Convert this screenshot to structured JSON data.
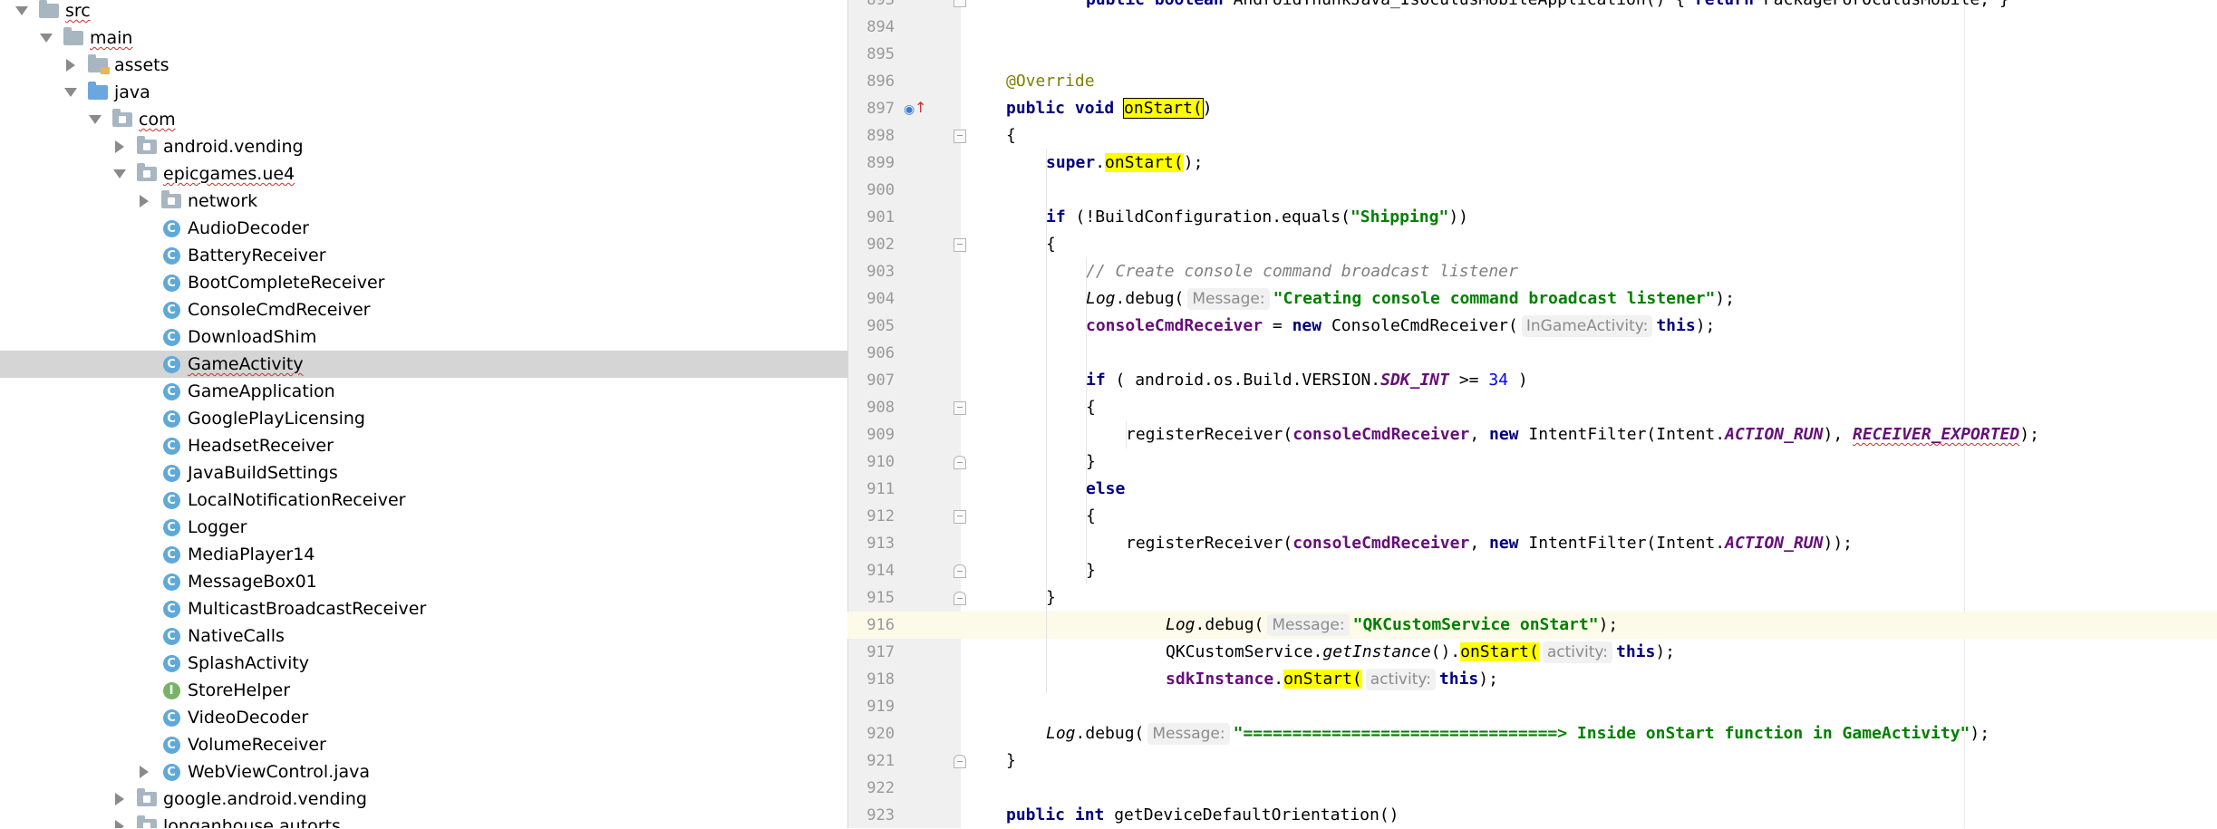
{
  "tree": {
    "items": [
      {
        "label": "src",
        "depth": 0,
        "expanded": true,
        "icon": "folder-icon"
      },
      {
        "label": "main",
        "depth": 1,
        "expanded": true,
        "icon": "folder-icon"
      },
      {
        "label": "assets",
        "depth": 2,
        "expanded": false,
        "icon": "resource-folder-icon"
      },
      {
        "label": "java",
        "depth": 2,
        "expanded": true,
        "icon": "source-folder-icon"
      },
      {
        "label": "com",
        "depth": 3,
        "expanded": true,
        "icon": "package-icon"
      },
      {
        "label": "android.vending",
        "depth": 4,
        "expanded": false,
        "icon": "package-icon"
      },
      {
        "label": "epicgames.ue4",
        "depth": 4,
        "expanded": true,
        "icon": "package-icon"
      },
      {
        "label": "network",
        "depth": 5,
        "expanded": false,
        "icon": "package-icon"
      },
      {
        "label": "AudioDecoder",
        "depth": 5,
        "icon": "class-icon"
      },
      {
        "label": "BatteryReceiver",
        "depth": 5,
        "icon": "class-icon"
      },
      {
        "label": "BootCompleteReceiver",
        "depth": 5,
        "icon": "class-icon"
      },
      {
        "label": "ConsoleCmdReceiver",
        "depth": 5,
        "icon": "class-icon"
      },
      {
        "label": "DownloadShim",
        "depth": 5,
        "icon": "class-icon"
      },
      {
        "label": "GameActivity",
        "depth": 5,
        "icon": "class-icon",
        "selected": true
      },
      {
        "label": "GameApplication",
        "depth": 5,
        "icon": "class-icon"
      },
      {
        "label": "GooglePlayLicensing",
        "depth": 5,
        "icon": "class-icon"
      },
      {
        "label": "HeadsetReceiver",
        "depth": 5,
        "icon": "class-icon"
      },
      {
        "label": "JavaBuildSettings",
        "depth": 5,
        "icon": "class-icon"
      },
      {
        "label": "LocalNotificationReceiver",
        "depth": 5,
        "icon": "class-icon"
      },
      {
        "label": "Logger",
        "depth": 5,
        "icon": "class-icon"
      },
      {
        "label": "MediaPlayer14",
        "depth": 5,
        "icon": "class-icon"
      },
      {
        "label": "MessageBox01",
        "depth": 5,
        "icon": "class-icon"
      },
      {
        "label": "MulticastBroadcastReceiver",
        "depth": 5,
        "icon": "class-icon"
      },
      {
        "label": "NativeCalls",
        "depth": 5,
        "icon": "class-icon"
      },
      {
        "label": "SplashActivity",
        "depth": 5,
        "icon": "class-icon"
      },
      {
        "label": "StoreHelper",
        "depth": 5,
        "icon": "interface-icon"
      },
      {
        "label": "VideoDecoder",
        "depth": 5,
        "icon": "class-icon"
      },
      {
        "label": "VolumeReceiver",
        "depth": 5,
        "icon": "class-icon"
      },
      {
        "label": "WebViewControl.java",
        "depth": 5,
        "expanded": false,
        "icon": "class-icon"
      },
      {
        "label": "google.android.vending",
        "depth": 4,
        "expanded": false,
        "icon": "package-icon"
      },
      {
        "label": "longanhouse.autorts",
        "depth": 4,
        "expanded": false,
        "icon": "package-icon"
      }
    ]
  },
  "editor": {
    "current_line": "916",
    "lines": [
      {
        "n": "893",
        "indent": 2,
        "tokens": [
          {
            "t": "public boolean ",
            "c": "kw"
          },
          {
            "t": "AndroidThunkJava_IsOculusMobileApplication() { "
          },
          {
            "t": "return ",
            "c": "kw"
          },
          {
            "t": "PackageForOculusMobile; }"
          }
        ]
      },
      {
        "n": "894",
        "indent": 0,
        "tokens": []
      },
      {
        "n": "895",
        "indent": 0,
        "tokens": []
      },
      {
        "n": "896",
        "indent": 0,
        "tokens": [
          {
            "t": "@Override",
            "c": "ann"
          }
        ]
      },
      {
        "n": "897",
        "indent": 0,
        "tokens": [
          {
            "t": "public void ",
            "c": "kw"
          },
          {
            "t": "onStart(",
            "c": "hlbox"
          },
          {
            "t": ")"
          }
        ]
      },
      {
        "n": "898",
        "indent": 0,
        "tokens": [
          {
            "t": "{"
          }
        ]
      },
      {
        "n": "899",
        "indent": 1,
        "tokens": [
          {
            "t": "super",
            "c": "kw"
          },
          {
            "t": "."
          },
          {
            "t": "onStart(",
            "c": "hl"
          },
          {
            "t": ");"
          }
        ]
      },
      {
        "n": "900",
        "indent": 0,
        "tokens": []
      },
      {
        "n": "901",
        "indent": 1,
        "tokens": [
          {
            "t": "if ",
            "c": "kw"
          },
          {
            "t": "(!BuildConfiguration.equals("
          },
          {
            "t": "\"Shipping\"",
            "c": "str"
          },
          {
            "t": "))"
          }
        ]
      },
      {
        "n": "902",
        "indent": 1,
        "tokens": [
          {
            "t": "{"
          }
        ]
      },
      {
        "n": "903",
        "indent": 2,
        "tokens": [
          {
            "t": "// Create console command broadcast listener",
            "c": "cmt"
          }
        ]
      },
      {
        "n": "904",
        "indent": 2,
        "tokens": [
          {
            "t": "Log",
            "c": "it"
          },
          {
            "t": ".debug("
          },
          {
            "hint": "Message:"
          },
          {
            "t": "\"Creating console command broadcast listener\"",
            "c": "str"
          },
          {
            "t": ");"
          }
        ]
      },
      {
        "n": "905",
        "indent": 2,
        "tokens": [
          {
            "t": "consoleCmdReceiver",
            "c": "fld"
          },
          {
            "t": " = "
          },
          {
            "t": "new ",
            "c": "kw"
          },
          {
            "t": "ConsoleCmdReceiver("
          },
          {
            "hint": "InGameActivity:"
          },
          {
            "t": "this",
            "c": "kw"
          },
          {
            "t": ");"
          }
        ]
      },
      {
        "n": "906",
        "indent": 0,
        "tokens": []
      },
      {
        "n": "907",
        "indent": 2,
        "tokens": [
          {
            "t": "if ",
            "c": "kw"
          },
          {
            "t": "( android.os.Build.VERSION."
          },
          {
            "t": "SDK_INT",
            "c": "sfld"
          },
          {
            "t": " >= "
          },
          {
            "t": "34",
            "c": "num"
          },
          {
            "t": " )"
          }
        ]
      },
      {
        "n": "908",
        "indent": 2,
        "tokens": [
          {
            "t": "{"
          }
        ]
      },
      {
        "n": "909",
        "indent": 3,
        "tokens": [
          {
            "t": "registerReceiver("
          },
          {
            "t": "consoleCmdReceiver",
            "c": "fld"
          },
          {
            "t": ", "
          },
          {
            "t": "new ",
            "c": "kw"
          },
          {
            "t": "IntentFilter(Intent."
          },
          {
            "t": "ACTION_RUN",
            "c": "sfld"
          },
          {
            "t": "), "
          },
          {
            "t": "RECEIVER_EXPORTED",
            "c": "sfld squig"
          },
          {
            "t": ");"
          }
        ]
      },
      {
        "n": "910",
        "indent": 2,
        "tokens": [
          {
            "t": "}"
          }
        ]
      },
      {
        "n": "911",
        "indent": 2,
        "tokens": [
          {
            "t": "else",
            "c": "kw"
          }
        ]
      },
      {
        "n": "912",
        "indent": 2,
        "tokens": [
          {
            "t": "{"
          }
        ]
      },
      {
        "n": "913",
        "indent": 3,
        "tokens": [
          {
            "t": "registerReceiver("
          },
          {
            "t": "consoleCmdReceiver",
            "c": "fld"
          },
          {
            "t": ", "
          },
          {
            "t": "new ",
            "c": "kw"
          },
          {
            "t": "IntentFilter(Intent."
          },
          {
            "t": "ACTION_RUN",
            "c": "sfld"
          },
          {
            "t": "));"
          }
        ]
      },
      {
        "n": "914",
        "indent": 2,
        "tokens": [
          {
            "t": "}"
          }
        ]
      },
      {
        "n": "915",
        "indent": 1,
        "tokens": [
          {
            "t": "}"
          }
        ]
      },
      {
        "n": "916",
        "indent": 4,
        "tokens": [
          {
            "t": "Log",
            "c": "it"
          },
          {
            "t": ".debug("
          },
          {
            "hint": "Message:"
          },
          {
            "t": "\"QKCustomService onStart\"",
            "c": "str"
          },
          {
            "t": ");"
          }
        ]
      },
      {
        "n": "917",
        "indent": 4,
        "tokens": [
          {
            "t": "QKCustomService."
          },
          {
            "t": "getInstance",
            "c": "it"
          },
          {
            "t": "()."
          },
          {
            "t": "onStart(",
            "c": "hl"
          },
          {
            "hint": "activity:"
          },
          {
            "t": "this",
            "c": "kw"
          },
          {
            "t": ");"
          }
        ]
      },
      {
        "n": "918",
        "indent": 4,
        "tokens": [
          {
            "t": "sdkInstance",
            "c": "fld"
          },
          {
            "t": "."
          },
          {
            "t": "onStart(",
            "c": "hl"
          },
          {
            "hint": "activity:"
          },
          {
            "t": "this",
            "c": "kw"
          },
          {
            "t": ");"
          }
        ]
      },
      {
        "n": "919",
        "indent": 0,
        "tokens": []
      },
      {
        "n": "920",
        "indent": 1,
        "tokens": [
          {
            "t": "Log",
            "c": "it"
          },
          {
            "t": ".debug("
          },
          {
            "hint": "Message:"
          },
          {
            "t": "\"================================> Inside onStart function in GameActivity\"",
            "c": "str"
          },
          {
            "t": ");"
          }
        ]
      },
      {
        "n": "921",
        "indent": 0,
        "tokens": [
          {
            "t": "}"
          }
        ]
      },
      {
        "n": "922",
        "indent": 0,
        "tokens": []
      },
      {
        "n": "923",
        "indent": 0,
        "tokens": [
          {
            "t": "public int ",
            "c": "kw"
          },
          {
            "t": "getDeviceDefaultOrientation()"
          }
        ]
      }
    ]
  }
}
